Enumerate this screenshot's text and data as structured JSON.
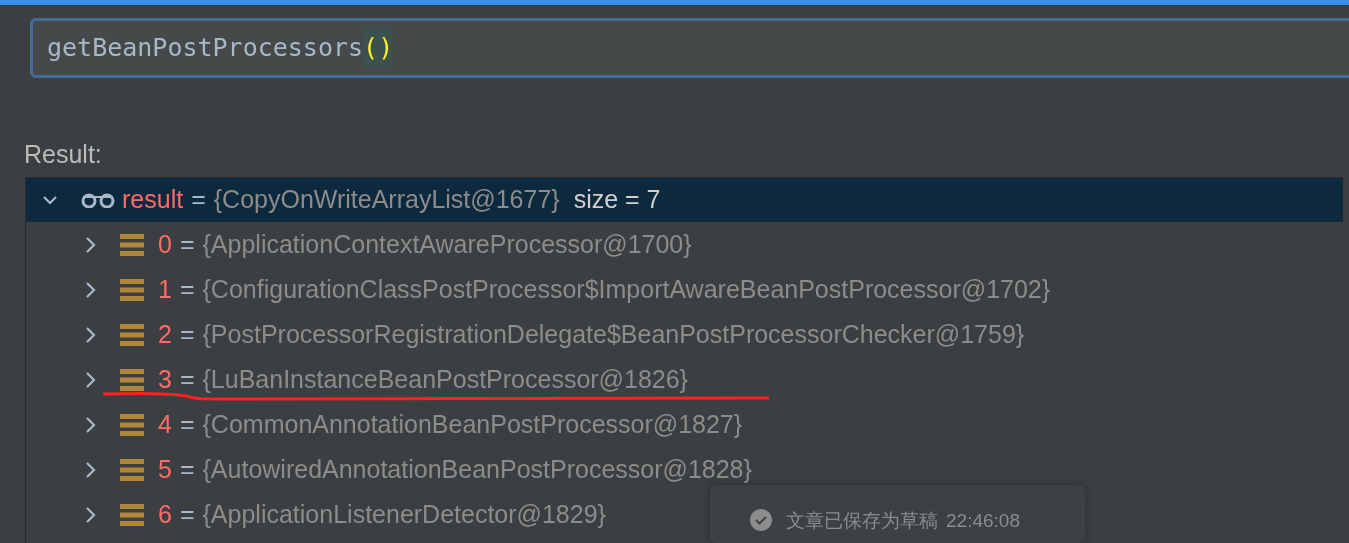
{
  "expression": {
    "value": "getBeanPostProcessors",
    "parens": "()"
  },
  "result_label": "Result:",
  "tree": {
    "name": "result",
    "separator": "=",
    "value": "{CopyOnWriteArrayList@1677}",
    "size": "size = 7",
    "expanded": true,
    "selected": true,
    "children": [
      {
        "index": "0",
        "separator": "=",
        "value": "{ApplicationContextAwareProcessor@1700}",
        "expanded": false,
        "selected": false,
        "underlined": false
      },
      {
        "index": "1",
        "separator": "=",
        "value": "{ConfigurationClassPostProcessor$ImportAwareBeanPostProcessor@1702}",
        "expanded": false,
        "selected": false,
        "underlined": false
      },
      {
        "index": "2",
        "separator": "=",
        "value": "{PostProcessorRegistrationDelegate$BeanPostProcessorChecker@1759}",
        "expanded": false,
        "selected": false,
        "underlined": false
      },
      {
        "index": "3",
        "separator": "=",
        "value": "{LuBanInstanceBeanPostProcessor@1826}",
        "expanded": false,
        "selected": false,
        "underlined": true
      },
      {
        "index": "4",
        "separator": "=",
        "value": "{CommonAnnotationBeanPostProcessor@1827}",
        "expanded": false,
        "selected": false,
        "underlined": false
      },
      {
        "index": "5",
        "separator": "=",
        "value": "{AutowiredAnnotationBeanPostProcessor@1828}",
        "expanded": false,
        "selected": false,
        "underlined": false
      },
      {
        "index": "6",
        "separator": "=",
        "value": "{ApplicationListenerDetector@1829}",
        "expanded": false,
        "selected": false,
        "underlined": false
      }
    ]
  },
  "toast": {
    "message": "文章已保存为草稿",
    "time": "22:46:08"
  }
}
